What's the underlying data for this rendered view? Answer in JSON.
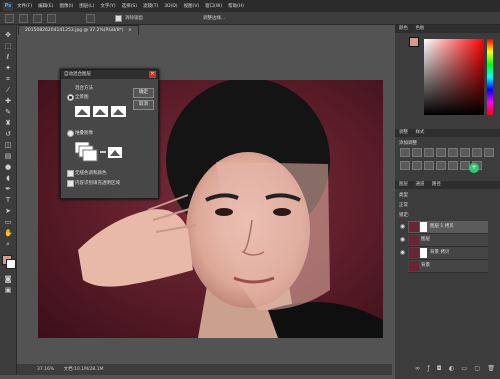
{
  "app": {
    "logo": "Ps"
  },
  "menu": [
    "文件(F)",
    "编辑(E)",
    "图像(I)",
    "图层(L)",
    "文字(Y)",
    "选择(S)",
    "滤镜(T)",
    "3D(D)",
    "视图(V)",
    "窗口(W)",
    "帮助(H)"
  ],
  "options": {
    "contiguous_label": "消除锯齿",
    "sample_label": "调整边缘..."
  },
  "document": {
    "tab_title": "20150826204141253.jpg @ 37.2%(RGB/8*)",
    "close": "×"
  },
  "status": {
    "zoom": "37.16%",
    "doc_size": "文档:10.1M/28.1M"
  },
  "dialog": {
    "title": "自动混合图层",
    "method_label": "混合方法",
    "option_panorama": "全景图",
    "option_stack": "堆叠图像",
    "ok": "确定",
    "cancel": "取消",
    "check_tones": "无缝色调和颜色",
    "check_fill": "内容识别填充透明区域",
    "close": "×"
  },
  "panels": {
    "color_tabs": [
      "颜色",
      "色板"
    ],
    "adjust_tabs": [
      "调整",
      "样式"
    ],
    "adjust_title": "添加调整",
    "layers_tabs": [
      "图层",
      "通道",
      "路径"
    ],
    "layers_kind": "类型",
    "layers_mode": "正常",
    "layers_lock": "锁定:",
    "layers": [
      {
        "name": "图层 1 拷贝",
        "selected": true
      },
      {
        "name": "图层",
        "selected": false
      },
      {
        "name": "背景 拷贝",
        "selected": false
      },
      {
        "name": "背景",
        "selected": false
      }
    ]
  },
  "colors": {
    "foreground": "#d79b8c",
    "background": "#ffffff",
    "photo_bg": "#6b2432",
    "accent": "#e02020"
  }
}
